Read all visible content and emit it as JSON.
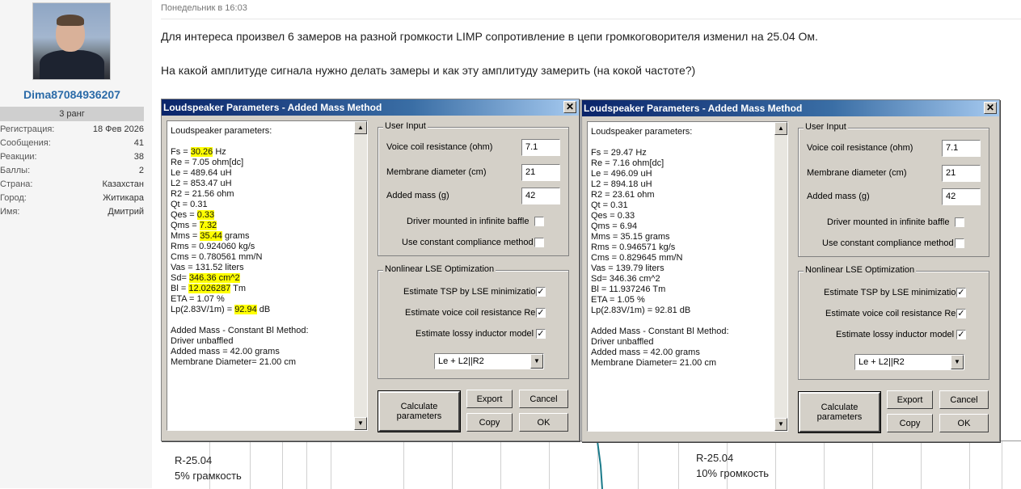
{
  "profile": {
    "username": "Dima87084936207",
    "rank": "3 ранг",
    "stats": [
      {
        "label": "Регистрация:",
        "value": "18 Фев 2026"
      },
      {
        "label": "Сообщения:",
        "value": "41"
      },
      {
        "label": "Реакции:",
        "value": "38"
      },
      {
        "label": "Баллы:",
        "value": "2"
      },
      {
        "label": "Страна:",
        "value": "Казахстан"
      },
      {
        "label": "Город:",
        "value": "Житикара"
      },
      {
        "label": "Имя:",
        "value": "Дмитрий"
      }
    ]
  },
  "post": {
    "time": "Понедельник в 16:03",
    "line1": "Для интереса произвел 6 замеров на разной громкости LIMP сопротивление в цепи громкоговорителя изменил на 25.04 Ом.",
    "line2": "На какой амплитуде сигнала нужно делать замеры и как эту амплитуду замерить (на кокой частоте?)"
  },
  "dialogs": [
    {
      "title": "Loudspeaker Parameters - Added Mass Method",
      "memo_header": "Loudspeaker parameters:",
      "params": [
        {
          "pre": "Fs  = ",
          "hl": "30.26",
          "post": " Hz"
        },
        {
          "pre": "Re  = 7.05 ohm[dc]",
          "hl": "",
          "post": ""
        },
        {
          "pre": "Le  = 489.64 uH",
          "hl": "",
          "post": ""
        },
        {
          "pre": "L2  = 853.47 uH",
          "hl": "",
          "post": ""
        },
        {
          "pre": "R2  = 21.56 ohm",
          "hl": "",
          "post": ""
        },
        {
          "pre": "Qt  = 0.31",
          "hl": "",
          "post": ""
        },
        {
          "pre": "Qes = ",
          "hl": "0.33",
          "post": ""
        },
        {
          "pre": "Qms = ",
          "hl": "7.32",
          "post": ""
        },
        {
          "pre": "Mms = ",
          "hl": "35.44",
          "post": " grams"
        },
        {
          "pre": "Rms = 0.924060 kg/s",
          "hl": "",
          "post": ""
        },
        {
          "pre": "Cms = 0.780561 mm/N",
          "hl": "",
          "post": ""
        },
        {
          "pre": "Vas = 131.52 liters",
          "hl": "",
          "post": ""
        },
        {
          "pre": "Sd= ",
          "hl": "346.36 cm^2",
          "post": ""
        },
        {
          "pre": "Bl  = ",
          "hl": "12.026287",
          "post": " Tm"
        },
        {
          "pre": "ETA = 1.07 %",
          "hl": "",
          "post": ""
        },
        {
          "pre": "Lp(2.83V/1m) = ",
          "hl": "92.94",
          "post": " dB"
        }
      ],
      "method": [
        "Added Mass - Constant Bl Method:",
        "Driver unbaffled",
        "Added mass = 42.00 grams",
        "Membrane Diameter= 21.00 cm"
      ],
      "user_input_title": "User Input",
      "voice_coil_label": "Voice coil resistance (ohm)",
      "voice_coil_value": "7.1",
      "membrane_label": "Membrane diameter (cm)",
      "membrane_value": "21",
      "added_mass_label": "Added mass (g)",
      "added_mass_value": "42",
      "infinite_baffle_label": "Driver mounted in infinite baffle",
      "infinite_baffle_checked": "",
      "constant_compliance_label": "Use constant compliance method",
      "constant_compliance_checked": "",
      "lse_title": "Nonlinear LSE Optimization",
      "tsp_label": "Estimate TSP by LSE minimization",
      "tsp_checked": "✓",
      "vcr_label": "Estimate voice coil resistance Re",
      "vcr_checked": "✓",
      "lossy_label": "Estimate lossy inductor model",
      "lossy_checked": "✓",
      "model_select": "Le + L2||R2",
      "calc_button": "Calculate parameters",
      "export_button": "Export",
      "cancel_button": "Cancel",
      "copy_button": "Copy",
      "ok_button": "OK"
    },
    {
      "title": "Loudspeaker Parameters - Added Mass Method",
      "memo_header": "Loudspeaker parameters:",
      "params": [
        {
          "pre": "Fs  = 29.47 Hz",
          "hl": "",
          "post": ""
        },
        {
          "pre": "Re  = 7.16 ohm[dc]",
          "hl": "",
          "post": ""
        },
        {
          "pre": "Le  = 496.09 uH",
          "hl": "",
          "post": ""
        },
        {
          "pre": "L2  = 894.18 uH",
          "hl": "",
          "post": ""
        },
        {
          "pre": "R2  = 23.61 ohm",
          "hl": "",
          "post": ""
        },
        {
          "pre": "Qt  = 0.31",
          "hl": "",
          "post": ""
        },
        {
          "pre": "Qes = 0.33",
          "hl": "",
          "post": ""
        },
        {
          "pre": "Qms = 6.94",
          "hl": "",
          "post": ""
        },
        {
          "pre": "Mms = 35.15 grams",
          "hl": "",
          "post": ""
        },
        {
          "pre": "Rms = 0.946571 kg/s",
          "hl": "",
          "post": ""
        },
        {
          "pre": "Cms = 0.829645 mm/N",
          "hl": "",
          "post": ""
        },
        {
          "pre": "Vas = 139.79 liters",
          "hl": "",
          "post": ""
        },
        {
          "pre": "Sd= 346.36 cm^2",
          "hl": "",
          "post": ""
        },
        {
          "pre": "Bl  = 11.937246 Tm",
          "hl": "",
          "post": ""
        },
        {
          "pre": "ETA = 1.05 %",
          "hl": "",
          "post": ""
        },
        {
          "pre": "Lp(2.83V/1m) = 92.81 dB",
          "hl": "",
          "post": ""
        }
      ],
      "method": [
        "Added Mass - Constant Bl Method:",
        "Driver unbaffled",
        "Added mass = 42.00 grams",
        "Membrane Diameter= 21.00 cm"
      ],
      "user_input_title": "User Input",
      "voice_coil_label": "Voice coil resistance (ohm)",
      "voice_coil_value": "7.1",
      "membrane_label": "Membrane diameter (cm)",
      "membrane_value": "21",
      "added_mass_label": "Added mass (g)",
      "added_mass_value": "42",
      "infinite_baffle_label": "Driver mounted in infinite baffle",
      "infinite_baffle_checked": "",
      "constant_compliance_label": "Use constant compliance method",
      "constant_compliance_checked": "",
      "lse_title": "Nonlinear LSE Optimization",
      "tsp_label": "Estimate TSP by LSE minimization",
      "tsp_checked": "✓",
      "vcr_label": "Estimate voice coil resistance Re",
      "vcr_checked": "✓",
      "lossy_label": "Estimate lossy inductor model",
      "lossy_checked": "✓",
      "model_select": "Le + L2||R2",
      "calc_button": "Calculate parameters",
      "export_button": "Export",
      "cancel_button": "Cancel",
      "copy_button": "Copy",
      "ok_button": "OK"
    }
  ],
  "graph_labels": [
    {
      "line1": "R-25.04",
      "line2": "5% грамкость"
    },
    {
      "line1": "R-25.04",
      "line2": "10% громкость"
    }
  ]
}
